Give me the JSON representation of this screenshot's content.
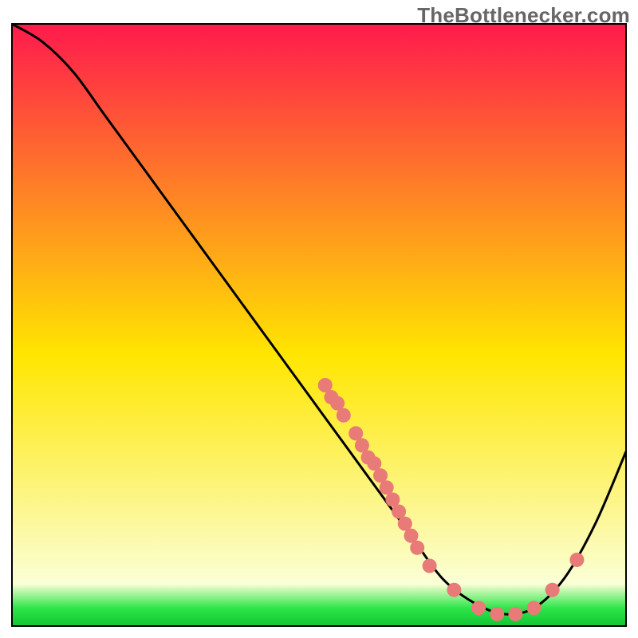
{
  "watermark": "TheBottlenecker.com",
  "colors": {
    "top": "#ff1a4d",
    "mid": "#ffe600",
    "green": "#2ee64a",
    "dot": "#e87a77",
    "line": "#000000"
  },
  "chart_data": {
    "type": "line",
    "title": "",
    "xlabel": "",
    "ylabel": "",
    "xlim": [
      0,
      100
    ],
    "ylim": [
      0,
      100
    ],
    "series": [
      {
        "name": "curve",
        "x": [
          0,
          5,
          10,
          15,
          20,
          25,
          30,
          35,
          40,
          45,
          50,
          55,
          60,
          65,
          70,
          75,
          80,
          85,
          90,
          95,
          100
        ],
        "y": [
          100,
          97,
          92,
          85,
          78,
          71,
          64,
          57,
          50,
          43,
          36,
          29,
          22,
          15,
          8,
          4,
          2,
          3,
          8,
          17,
          29
        ]
      }
    ],
    "scatter": [
      {
        "x": 51,
        "y": 40
      },
      {
        "x": 52,
        "y": 38
      },
      {
        "x": 53,
        "y": 37
      },
      {
        "x": 54,
        "y": 35
      },
      {
        "x": 56,
        "y": 32
      },
      {
        "x": 57,
        "y": 30
      },
      {
        "x": 58,
        "y": 28
      },
      {
        "x": 59,
        "y": 27
      },
      {
        "x": 60,
        "y": 25
      },
      {
        "x": 61,
        "y": 23
      },
      {
        "x": 62,
        "y": 21
      },
      {
        "x": 63,
        "y": 19
      },
      {
        "x": 64,
        "y": 17
      },
      {
        "x": 65,
        "y": 15
      },
      {
        "x": 66,
        "y": 13
      },
      {
        "x": 68,
        "y": 10
      },
      {
        "x": 72,
        "y": 6
      },
      {
        "x": 76,
        "y": 3
      },
      {
        "x": 79,
        "y": 2
      },
      {
        "x": 82,
        "y": 2
      },
      {
        "x": 85,
        "y": 3
      },
      {
        "x": 88,
        "y": 6
      },
      {
        "x": 92,
        "y": 11
      }
    ]
  }
}
